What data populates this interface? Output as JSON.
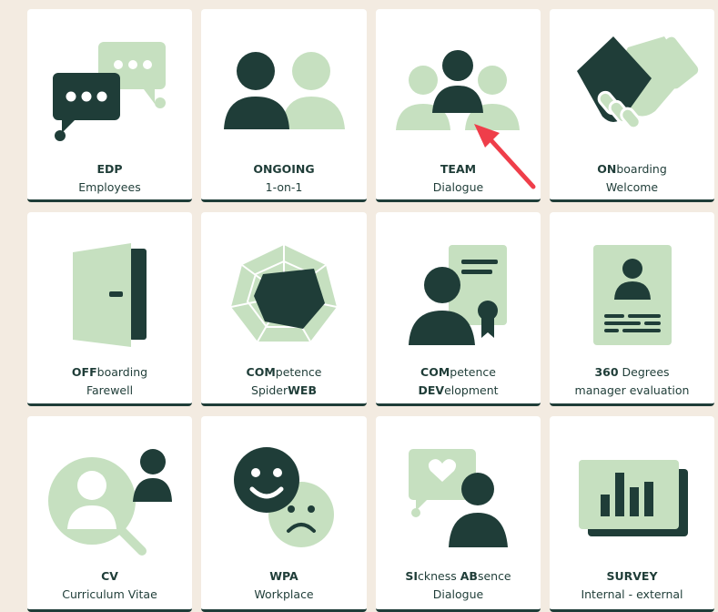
{
  "colors": {
    "background": "#f3ebe1",
    "tile": "#ffffff",
    "dark": "#1f3d38",
    "light": "#c6e0c0",
    "accent_arrow": "#ef3e4a"
  },
  "tiles": [
    {
      "id": "edp",
      "l1a": "EDP",
      "l1b": "",
      "l2a": "Employees",
      "l2b": "",
      "icon": "chat-bubbles-icon"
    },
    {
      "id": "ongoing",
      "l1a": "ONGOING",
      "l1b": "",
      "l2a": "1-on-1",
      "l2b": "",
      "icon": "two-people-icon"
    },
    {
      "id": "team",
      "l1a": "TEAM",
      "l1b": "",
      "l2a": "Dialogue",
      "l2b": "",
      "icon": "team-icon"
    },
    {
      "id": "onboarding",
      "l1a": "ON",
      "l1b": "boarding",
      "l2a": "Welcome",
      "l2b": "",
      "icon": "handshake-icon"
    },
    {
      "id": "offboarding",
      "l1a": "OFF",
      "l1b": "boarding",
      "l2a": "Farewell",
      "l2b": "",
      "icon": "door-icon"
    },
    {
      "id": "competence-spiderweb",
      "l1a": "COM",
      "l1b": "petence",
      "l2a": "Spider",
      "l2b": "WEB",
      "icon": "spiderweb-icon"
    },
    {
      "id": "competence-development",
      "l1a": "COM",
      "l1b": "petence",
      "l2a": "DEV",
      "l2b": "elopment",
      "icon": "certificate-person-icon"
    },
    {
      "id": "360",
      "l1a": "360",
      "l1b": " Degrees",
      "l2a": "manager evaluation",
      "l2b": "",
      "icon": "id-card-icon"
    },
    {
      "id": "cv",
      "l1a": "CV",
      "l1b": "",
      "l2a": "Curriculum Vitae",
      "l2b": "",
      "icon": "search-person-icon"
    },
    {
      "id": "wpa",
      "l1a": "WPA",
      "l1b": "",
      "l2a": "Workplace",
      "l2b": "",
      "icon": "smileys-icon"
    },
    {
      "id": "sickness",
      "l1a": "SI",
      "l1b": "ckness ",
      "l1c": "AB",
      "l1d": "sence",
      "l2a": "Dialogue",
      "l2b": "",
      "icon": "heart-bubble-person-icon"
    },
    {
      "id": "survey",
      "l1a": "SURVEY",
      "l1b": "",
      "l2a": "Internal - external",
      "l2b": "",
      "icon": "bar-chart-icon"
    }
  ]
}
